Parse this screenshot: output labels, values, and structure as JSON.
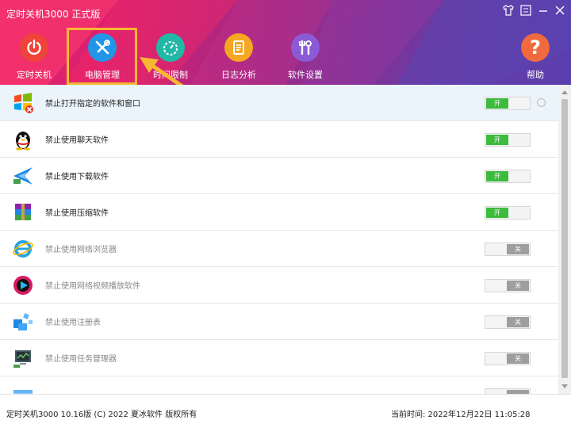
{
  "app": {
    "title": "定时关机3000 正式版"
  },
  "window_controls": [
    {
      "name": "skin-icon",
      "glyph": "👕"
    },
    {
      "name": "menu-icon",
      "glyph": "☰"
    },
    {
      "name": "minimize-icon",
      "glyph": "—"
    },
    {
      "name": "close-icon",
      "glyph": "✕"
    }
  ],
  "toolbar": {
    "items": [
      {
        "label": "定时关机",
        "icon": "power-icon",
        "color": "#f0433a"
      },
      {
        "label": "电脑管理",
        "icon": "tools-icon",
        "color": "#2196e8"
      },
      {
        "label": "时间限制",
        "icon": "timer-icon",
        "color": "#22b8a6"
      },
      {
        "label": "日志分析",
        "icon": "log-icon",
        "color": "#f5a623"
      },
      {
        "label": "软件设置",
        "icon": "settings-icon",
        "color": "#8b5bd6"
      },
      {
        "label": "帮助",
        "icon": "help-icon",
        "color": "#f06a3e"
      }
    ],
    "active_index": 1,
    "highlight_color": "#f7b733"
  },
  "list": {
    "rows": [
      {
        "text": "禁止打开指定的软件和窗口",
        "state_label": "开",
        "enabled": true,
        "icon": "windows-icon"
      },
      {
        "text": "禁止使用聊天软件",
        "state_label": "开",
        "enabled": true,
        "icon": "qq-penguin-icon"
      },
      {
        "text": "禁止使用下载软件",
        "state_label": "开",
        "enabled": true,
        "icon": "download-bird-icon"
      },
      {
        "text": "禁止使用压缩软件",
        "state_label": "开",
        "enabled": true,
        "icon": "archive-books-icon"
      },
      {
        "text": "禁止使用网络浏览器",
        "state_label": "关",
        "enabled": false,
        "icon": "ie-browser-icon"
      },
      {
        "text": "禁止使用网络视频播放软件",
        "state_label": "关",
        "enabled": false,
        "icon": "video-player-icon"
      },
      {
        "text": "禁止使用注册表",
        "state_label": "关",
        "enabled": false,
        "icon": "registry-cubes-icon"
      },
      {
        "text": "禁止使用任务管理器",
        "state_label": "关",
        "enabled": false,
        "icon": "task-manager-icon"
      },
      {
        "text": "",
        "state_label": "",
        "enabled": false,
        "icon": "control-panel-icon"
      }
    ]
  },
  "footer": {
    "copyright": "定时关机3000 10.16版 (C) 2022  夏冰软件 版权所有",
    "time": "当前时间:  2022年12月22日 11:05:28"
  },
  "colors": {
    "on": "#3dbb3d",
    "off": "#9e9e9e"
  }
}
